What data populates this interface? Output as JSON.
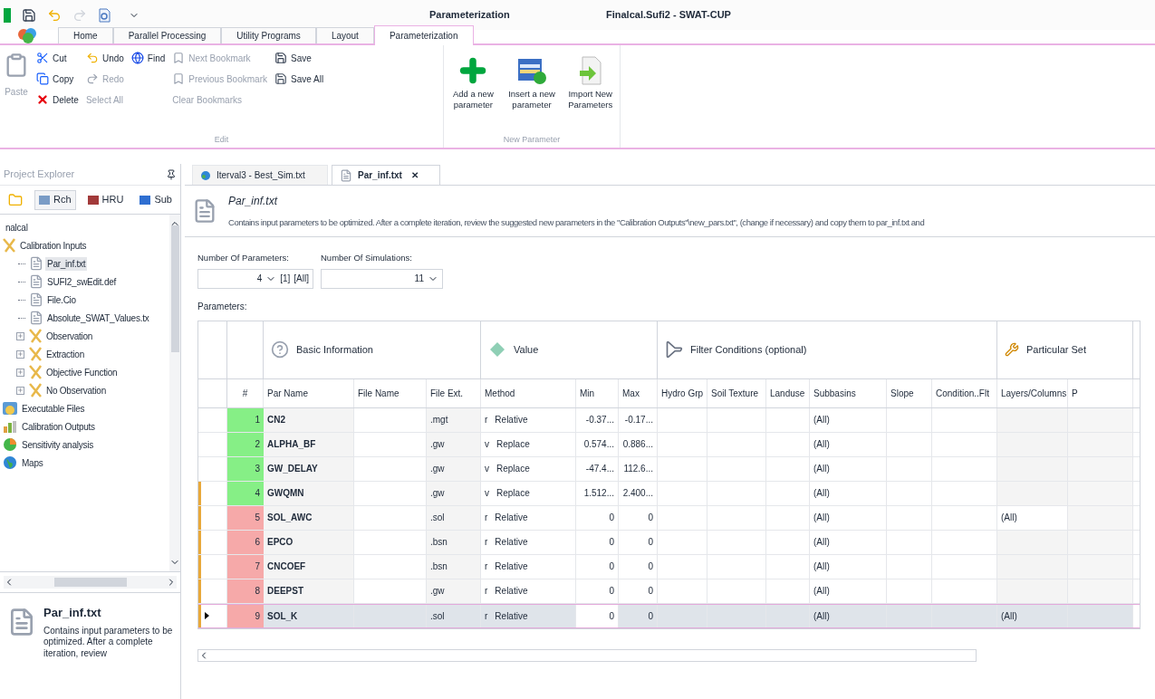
{
  "window": {
    "title": "Parameterization",
    "document_title": "Finalcal.Sufi2  - SWAT-CUP"
  },
  "ribbon_tabs": [
    {
      "label": "Home",
      "selected": false
    },
    {
      "label": "Parallel Processing",
      "selected": false
    },
    {
      "label": "Utility Programs",
      "selected": false
    },
    {
      "label": "Layout",
      "selected": false
    },
    {
      "label": "Parameterization",
      "selected": true
    }
  ],
  "edit_group": {
    "label": "Edit",
    "columns": [
      [
        {
          "kind": "paste",
          "label": "Paste",
          "disabled": true
        }
      ],
      [
        {
          "kind": "cut",
          "label": "Cut",
          "disabled": false
        },
        {
          "kind": "copy",
          "label": "Copy",
          "disabled": false
        },
        {
          "kind": "delete",
          "label": "Delete",
          "disabled": false
        }
      ],
      [
        {
          "kind": "undo",
          "label": "Undo",
          "disabled": false
        },
        {
          "kind": "redo",
          "label": "Redo",
          "disabled": true
        },
        {
          "kind": "none",
          "label": "Select All",
          "disabled": true
        }
      ],
      [
        {
          "kind": "find",
          "label": "Find",
          "disabled": false
        }
      ],
      [
        {
          "kind": "bookmark",
          "label": "Next Bookmark",
          "disabled": true
        },
        {
          "kind": "bookmark",
          "label": "Previous Bookmark",
          "disabled": true
        },
        {
          "kind": "none",
          "label": "Clear Bookmarks",
          "disabled": true
        }
      ],
      [
        {
          "kind": "save",
          "label": "Save",
          "disabled": false
        },
        {
          "kind": "saveall",
          "label": "Save All",
          "disabled": false
        }
      ]
    ]
  },
  "new_parameter_group": {
    "label": "New Parameter",
    "buttons": [
      {
        "kind": "add",
        "label": "Add a new parameter"
      },
      {
        "kind": "insert",
        "label": "Insert a new parameter"
      },
      {
        "kind": "import",
        "label": "Import New Parameters"
      }
    ]
  },
  "project_explorer": {
    "title": "Project Explorer",
    "toolbar": [
      {
        "kind": "folder",
        "selected": false
      },
      {
        "kind": "rch",
        "label": "Rch",
        "selected": true
      },
      {
        "kind": "hru",
        "label": "HRU",
        "selected": false
      },
      {
        "kind": "sub",
        "label": "Sub",
        "selected": false
      }
    ],
    "tree": [
      {
        "label": "nalcal",
        "selected": false,
        "children": [
          {
            "label": "Calibration Inputs",
            "kind": "calib",
            "selected": false,
            "children": [
              {
                "label": "Par_inf.txt",
                "kind": "file",
                "selected": true
              },
              {
                "label": "SUFI2_swEdit.def",
                "kind": "file",
                "selected": false
              },
              {
                "label": "File.Cio",
                "kind": "file",
                "selected": false
              },
              {
                "label": "Absolute_SWAT_Values.tx",
                "kind": "file",
                "selected": false
              },
              {
                "label": "Observation",
                "kind": "calib",
                "selected": false,
                "expanded": false
              },
              {
                "label": "Extraction",
                "kind": "calib",
                "selected": false,
                "expanded": false
              },
              {
                "label": "Objective Function",
                "kind": "calib",
                "selected": false,
                "expanded": false
              },
              {
                "label": "No Observation",
                "kind": "calib",
                "selected": false,
                "expanded": false
              }
            ]
          },
          {
            "label": "Executable Files",
            "kind": "exe",
            "selected": false
          },
          {
            "label": "Calibration Outputs",
            "kind": "output",
            "selected": false
          },
          {
            "label": "Sensitivity analysis",
            "kind": "sensitivity",
            "selected": false
          },
          {
            "label": "Maps",
            "kind": "maps",
            "selected": false
          }
        ]
      }
    ],
    "description": {
      "title": "Par_inf.txt",
      "text": "Contains input parameters to be optimized. After a complete iteration, review"
    }
  },
  "doc_tabs": [
    {
      "label": "Iterval3 - Best_Sim.txt",
      "kind": "sim",
      "selected": false
    },
    {
      "label": "Par_inf.txt",
      "kind": "file",
      "selected": true,
      "close": "✕"
    }
  ],
  "file_header": {
    "title": "Par_inf.txt",
    "text": "Contains input parameters to be optimized. After a complete iteration, review the suggested new parameters in the \"Calibration Outputs\"\\new_pars.txt\", (change if necessary) and copy them to par_inf.txt and"
  },
  "num_parameters": {
    "label": "Number Of Parameters:",
    "value": "4",
    "extra": [
      "[1]",
      "[All]"
    ]
  },
  "num_simulations": {
    "label": "Number Of Simulations:",
    "value": "11"
  },
  "parameters_label": "Parameters:",
  "column_groups": [
    {
      "label": "Basic Information",
      "kind": "info"
    },
    {
      "label": "Value",
      "kind": "value"
    },
    {
      "label": "Filter Conditions (optional)",
      "kind": "filter"
    },
    {
      "label": "Particular Set",
      "kind": "particular"
    }
  ],
  "columns": [
    "#",
    "Par Name",
    "File Name",
    "File Ext.",
    "Method",
    "Min",
    "Max",
    "Hydro Grp",
    "Soil Texture",
    "Landuse",
    "Subbasins",
    "Slope",
    "Condition..Flt",
    "Layers/Columns",
    "P"
  ],
  "rows": [
    {
      "num": "1",
      "name": "CN2",
      "ext": ".mgt",
      "method_code": "r",
      "method": "Relative",
      "min": "-0.37...",
      "max": "-0.17...",
      "subbasins": "(All)",
      "color": "#86ef86",
      "flagged": false,
      "selected": false
    },
    {
      "num": "2",
      "name": "ALPHA_BF",
      "ext": ".gw",
      "method_code": "v",
      "method": "Replace",
      "min": "0.574...",
      "max": "0.886...",
      "subbasins": "(All)",
      "color": "#86ef86",
      "flagged": false,
      "selected": false
    },
    {
      "num": "3",
      "name": "GW_DELAY",
      "ext": ".gw",
      "method_code": "v",
      "method": "Replace",
      "min": "-47.4...",
      "max": "112.6...",
      "subbasins": "(All)",
      "color": "#86ef86",
      "flagged": false,
      "selected": false
    },
    {
      "num": "4",
      "name": "GWQMN",
      "ext": ".gw",
      "method_code": "v",
      "method": "Replace",
      "min": "1.512...",
      "max": "2.400...",
      "subbasins": "(All)",
      "color": "#86ef86",
      "flagged": true,
      "selected": false
    },
    {
      "num": "5",
      "name": "SOL_AWC",
      "ext": ".sol",
      "method_code": "r",
      "method": "Relative",
      "min": "0",
      "max": "0",
      "subbasins": "(All)",
      "layers": "(All)",
      "color": "#f6a9a9",
      "flagged": true,
      "selected": false
    },
    {
      "num": "6",
      "name": "EPCO",
      "ext": ".bsn",
      "method_code": "r",
      "method": "Relative",
      "min": "0",
      "max": "0",
      "subbasins": "(All)",
      "color": "#f6a9a9",
      "flagged": true,
      "selected": false
    },
    {
      "num": "7",
      "name": "CNCOEF",
      "ext": ".bsn",
      "method_code": "r",
      "method": "Relative",
      "min": "0",
      "max": "0",
      "subbasins": "(All)",
      "color": "#f6a9a9",
      "flagged": true,
      "selected": false
    },
    {
      "num": "8",
      "name": "DEEPST",
      "ext": ".gw",
      "method_code": "r",
      "method": "Relative",
      "min": "0",
      "max": "0",
      "subbasins": "(All)",
      "color": "#f6a9a9",
      "flagged": true,
      "selected": false
    },
    {
      "num": "9",
      "name": "SOL_K",
      "ext": ".sol",
      "method_code": "r",
      "method": "Relative",
      "min": "0",
      "max": "0",
      "subbasins": "(All)",
      "layers": "(All)",
      "color": "#f6a9a9",
      "flagged": true,
      "selected": true
    }
  ]
}
